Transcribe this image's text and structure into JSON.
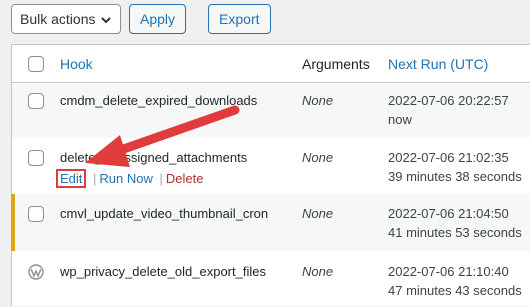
{
  "toolbar": {
    "bulk_actions": "Bulk actions",
    "apply": "Apply",
    "export": "Export"
  },
  "table": {
    "headers": {
      "hook": "Hook",
      "arguments": "Arguments",
      "next_run": "Next Run (UTC)"
    },
    "rows": [
      {
        "hook": "cmdm_delete_expired_downloads",
        "arguments": "None",
        "next_run_date": "2022-07-06 20:22:57",
        "next_run_rel": "now"
      },
      {
        "hook": "delete_unassigned_attachments",
        "arguments": "None",
        "next_run_date": "2022-07-06 21:02:35",
        "next_run_rel": "39 minutes 38 seconds",
        "actions": {
          "edit": "Edit",
          "run_now": "Run Now",
          "sep": "|",
          "delete": "Delete"
        }
      },
      {
        "hook": "cmvl_update_video_thumbnail_cron",
        "arguments": "None",
        "next_run_date": "2022-07-06 21:04:50",
        "next_run_rel": "41 minutes 53 seconds"
      },
      {
        "hook": "wp_privacy_delete_old_export_files",
        "arguments": "None",
        "next_run_date": "2022-07-06 21:10:40",
        "next_run_rel": "47 minutes 43 seconds"
      }
    ]
  },
  "colors": {
    "link": "#2271b1",
    "delete": "#b32d2e",
    "highlight_bar": "#dba617",
    "annotation_arrow": "#e03c3c"
  },
  "icons": {
    "core_row": "wordpress-icon",
    "select_chevron": "chevron-down-icon"
  }
}
